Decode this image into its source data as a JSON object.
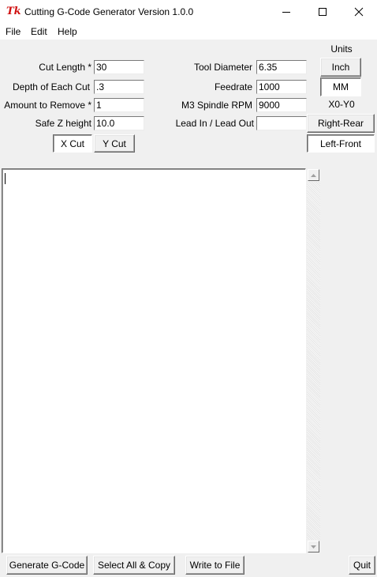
{
  "window": {
    "title": "Cutting G-Code Generator Version 1.0.0",
    "icon_text": "Tk",
    "icon_color": "#d01010"
  },
  "menu": [
    "File",
    "Edit",
    "Help"
  ],
  "form_left": [
    {
      "label": "Cut Length *",
      "value": "30"
    },
    {
      "label": "Depth of Each Cut",
      "value": ".3"
    },
    {
      "label": "Amount to Remove *",
      "value": "1"
    },
    {
      "label": "Safe Z height",
      "value": "10.0"
    }
  ],
  "form_right": [
    {
      "label": "Tool Diameter",
      "value": "6.35"
    },
    {
      "label": "Feedrate",
      "value": "1000"
    },
    {
      "label": "M3 Spindle RPM",
      "value": "9000"
    },
    {
      "label": "Lead In / Lead Out",
      "value": ""
    }
  ],
  "cut_axis": {
    "x_label": "X Cut",
    "y_label": "Y Cut",
    "selected": "X Cut"
  },
  "units": {
    "heading": "Units",
    "inch_label": "Inch",
    "mm_label": "MM",
    "selected": "MM"
  },
  "origin": {
    "heading": "X0-Y0",
    "right_rear_label": "Right-Rear",
    "left_front_label": "Left-Front",
    "selected": "Left-Front"
  },
  "output": {
    "text": ""
  },
  "bottom_buttons": {
    "generate": "Generate G-Code",
    "select_copy": "Select All & Copy",
    "write_file": "Write to File",
    "quit": "Quit"
  }
}
